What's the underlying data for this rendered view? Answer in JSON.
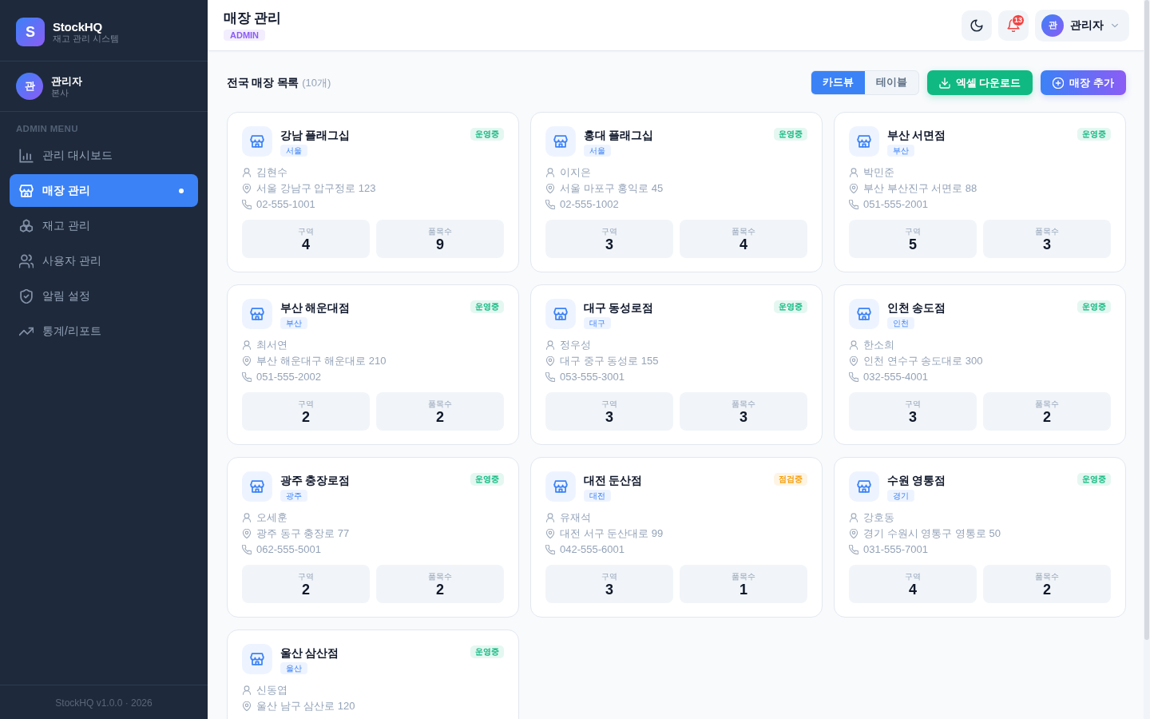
{
  "sidebar": {
    "logo": {
      "letter": "S",
      "name": "StockHQ",
      "subtitle": "재고 관리 시스템"
    },
    "user": {
      "avatar": "관",
      "name": "관리자",
      "branch": "본사"
    },
    "menu_heading": "ADMIN MENU",
    "items": [
      {
        "label": "관리 대시보드",
        "kind": "dashboard",
        "selected": false
      },
      {
        "label": "매장 관리",
        "kind": "stores",
        "selected": true
      },
      {
        "label": "재고 관리",
        "kind": "inventory",
        "selected": false
      },
      {
        "label": "사용자 관리",
        "kind": "users",
        "selected": false
      },
      {
        "label": "알림 설정",
        "kind": "alerts",
        "selected": false
      },
      {
        "label": "통계/리포트",
        "kind": "reports",
        "selected": false
      }
    ],
    "footer": "StockHQ v1.0.0 · 2026"
  },
  "header": {
    "title": "매장 관리",
    "role": "ADMIN",
    "notifications": "13",
    "user": {
      "avatar": "관",
      "name": "관리자"
    }
  },
  "toolbar": {
    "title": "전국 매장 목록",
    "count": "(10개)",
    "view_tabs": [
      {
        "label": "카드뷰",
        "selected": true
      },
      {
        "label": "테이블",
        "selected": false
      }
    ],
    "buttons": [
      {
        "label": "엑셀 다운로드",
        "kind": "download"
      },
      {
        "label": "매장 추가",
        "kind": "add"
      }
    ]
  },
  "stores": [
    {
      "name": "강남 플래그십",
      "region": "서울",
      "status": {
        "label": "운영중",
        "color": "#10b981"
      },
      "manager": "김현수",
      "address": "서울 강남구 압구정로 123",
      "phone": "02-555-1001",
      "stats": [
        {
          "label": "구역",
          "value": "4"
        },
        {
          "label": "품목수",
          "value": "9"
        }
      ]
    },
    {
      "name": "홍대 플래그십",
      "region": "서울",
      "status": {
        "label": "운영중",
        "color": "#10b981"
      },
      "manager": "이지은",
      "address": "서울 마포구 홍익로 45",
      "phone": "02-555-1002",
      "stats": [
        {
          "label": "구역",
          "value": "3"
        },
        {
          "label": "품목수",
          "value": "4"
        }
      ]
    },
    {
      "name": "부산 서면점",
      "region": "부산",
      "status": {
        "label": "운영중",
        "color": "#10b981"
      },
      "manager": "박민준",
      "address": "부산 부산진구 서면로 88",
      "phone": "051-555-2001",
      "stats": [
        {
          "label": "구역",
          "value": "5"
        },
        {
          "label": "품목수",
          "value": "3"
        }
      ]
    },
    {
      "name": "부산 해운대점",
      "region": "부산",
      "status": {
        "label": "운영중",
        "color": "#10b981"
      },
      "manager": "최서연",
      "address": "부산 해운대구 해운대로 210",
      "phone": "051-555-2002",
      "stats": [
        {
          "label": "구역",
          "value": "2"
        },
        {
          "label": "품목수",
          "value": "2"
        }
      ]
    },
    {
      "name": "대구 동성로점",
      "region": "대구",
      "status": {
        "label": "운영중",
        "color": "#10b981"
      },
      "manager": "정우성",
      "address": "대구 중구 동성로 155",
      "phone": "053-555-3001",
      "stats": [
        {
          "label": "구역",
          "value": "3"
        },
        {
          "label": "품목수",
          "value": "3"
        }
      ]
    },
    {
      "name": "인천 송도점",
      "region": "인천",
      "status": {
        "label": "운영중",
        "color": "#10b981"
      },
      "manager": "한소희",
      "address": "인천 연수구 송도대로 300",
      "phone": "032-555-4001",
      "stats": [
        {
          "label": "구역",
          "value": "3"
        },
        {
          "label": "품목수",
          "value": "2"
        }
      ]
    },
    {
      "name": "광주 충장로점",
      "region": "광주",
      "status": {
        "label": "운영중",
        "color": "#10b981"
      },
      "manager": "오세훈",
      "address": "광주 동구 충장로 77",
      "phone": "062-555-5001",
      "stats": [
        {
          "label": "구역",
          "value": "2"
        },
        {
          "label": "품목수",
          "value": "2"
        }
      ]
    },
    {
      "name": "대전 둔산점",
      "region": "대전",
      "status": {
        "label": "점검중",
        "color": "#f59e0b"
      },
      "manager": "유재석",
      "address": "대전 서구 둔산대로 99",
      "phone": "042-555-6001",
      "stats": [
        {
          "label": "구역",
          "value": "3"
        },
        {
          "label": "품목수",
          "value": "1"
        }
      ]
    },
    {
      "name": "수원 영통점",
      "region": "경기",
      "status": {
        "label": "운영중",
        "color": "#10b981"
      },
      "manager": "강호동",
      "address": "경기 수원시 영통구 영통로 50",
      "phone": "031-555-7001",
      "stats": [
        {
          "label": "구역",
          "value": "4"
        },
        {
          "label": "품목수",
          "value": "2"
        }
      ]
    },
    {
      "name": "울산 삼산점",
      "region": "울산",
      "status": {
        "label": "운영중",
        "color": "#10b981"
      },
      "manager": "신동엽",
      "address": "울산 남구 삼산로 120"
    }
  ]
}
